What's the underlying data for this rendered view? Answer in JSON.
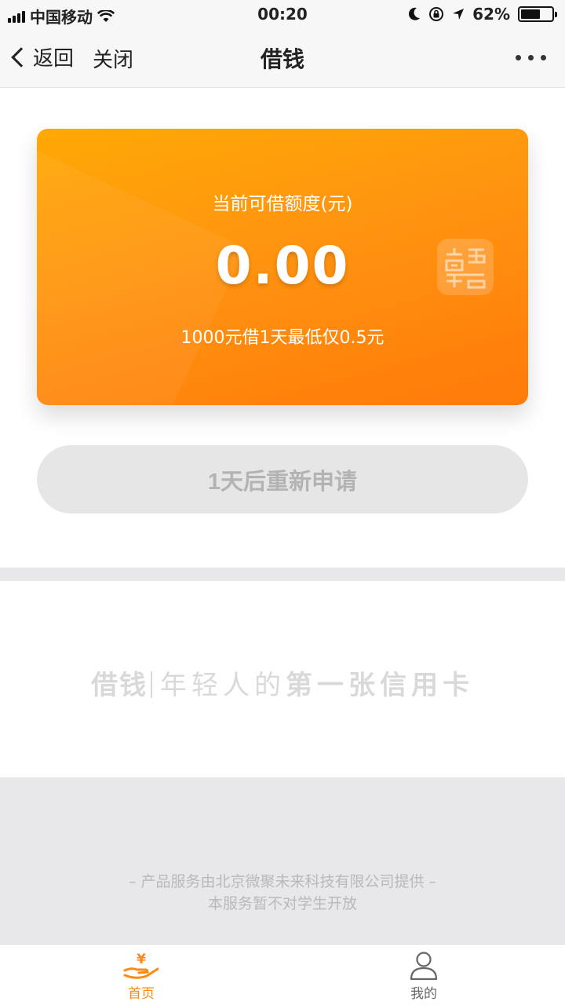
{
  "status_bar": {
    "carrier": "中国移动",
    "time": "00:20",
    "battery_percent": "62%",
    "battery_level": 0.62
  },
  "nav": {
    "back_label": "返回",
    "close_label": "关闭",
    "title": "借钱"
  },
  "card": {
    "label": "当前可借额度(元)",
    "amount": "0.00",
    "note": "1000元借1天最低仅0.5元"
  },
  "apply_button": {
    "label": "1天后重新申请"
  },
  "slogan": {
    "brand": "借钱",
    "part1": "年轻人的",
    "part2": "第一张信用卡"
  },
  "footer": {
    "line1": "– 产品服务由北京微聚未来科技有限公司提供 –",
    "line2": "本服务暂不对学生开放"
  },
  "tabs": [
    {
      "label": "首页",
      "active": true
    },
    {
      "label": "我的",
      "active": false
    }
  ],
  "colors": {
    "accent": "#ff8a0f",
    "card_top": "#ffa905",
    "card_bottom": "#ff7a0a",
    "disabled_button": "#e6e6e6"
  }
}
